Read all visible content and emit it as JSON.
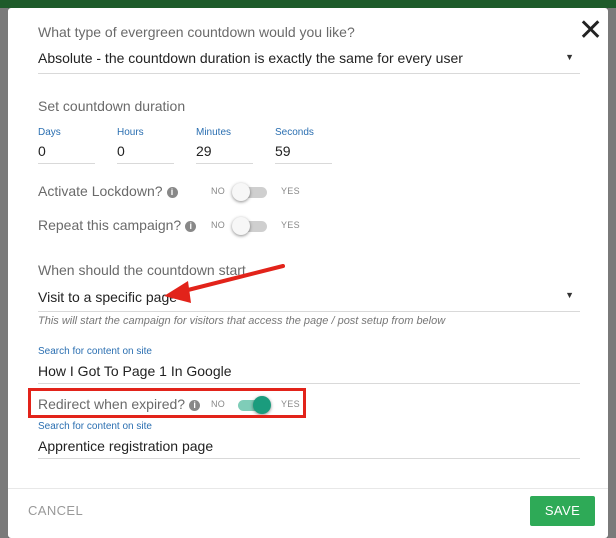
{
  "modal": {
    "close_symbol": "✕",
    "countdown_type": {
      "question": "What type of evergreen countdown would you like?",
      "selected": "Absolute - the countdown duration is exactly the same for every user"
    },
    "duration": {
      "heading": "Set countdown duration",
      "fields": [
        {
          "label": "Days",
          "value": "0"
        },
        {
          "label": "Hours",
          "value": "0"
        },
        {
          "label": "Minutes",
          "value": "29"
        },
        {
          "label": "Seconds",
          "value": "59"
        }
      ]
    },
    "lockdown": {
      "label": "Activate Lockdown?",
      "no": "NO",
      "yes": "YES",
      "enabled": false
    },
    "repeat": {
      "label": "Repeat this campaign?",
      "no": "NO",
      "yes": "YES",
      "enabled": false
    },
    "start": {
      "question": "When should the countdown start",
      "selected": "Visit to a specific page",
      "hint": "This will start the campaign for visitors that access the page / post setup from below"
    },
    "start_page": {
      "label": "Search for content on site",
      "value": "How I Got To Page 1 In Google"
    },
    "redirect": {
      "label": "Redirect when expired?",
      "no": "NO",
      "yes": "YES",
      "enabled": true
    },
    "redirect_page": {
      "label": "Search for content on site",
      "value": "Apprentice registration page"
    },
    "info_glyph": "i",
    "caret_glyph": "▼"
  },
  "footer": {
    "cancel_label": "CANCEL",
    "save_label": "SAVE"
  },
  "colors": {
    "accent_blue": "#2b6fb1",
    "toggle_on": "#1a9c7d",
    "save_green": "#2eaa57",
    "annotation_red": "#e2231a"
  }
}
